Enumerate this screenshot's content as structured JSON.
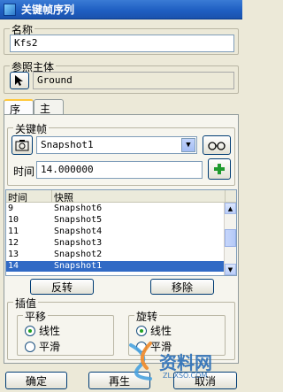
{
  "window": {
    "title": "关键帧序列"
  },
  "name_section": {
    "label": "名称",
    "value": "Kfs2"
  },
  "ref_section": {
    "label": "参照主体",
    "value": "Ground"
  },
  "tabs": [
    {
      "label": "序列",
      "active": true
    },
    {
      "label": "主体",
      "active": false
    }
  ],
  "keyframe": {
    "group_label": "关键帧",
    "selected": "Snapshot1",
    "time_label": "时间",
    "time_value": "14.000000"
  },
  "list": {
    "columns": [
      "时间",
      "快照"
    ],
    "rows": [
      {
        "time": "9",
        "snapshot": "Snapshot6"
      },
      {
        "time": "10",
        "snapshot": "Snapshot5"
      },
      {
        "time": "11",
        "snapshot": "Snapshot4"
      },
      {
        "time": "12",
        "snapshot": "Snapshot3"
      },
      {
        "time": "13",
        "snapshot": "Snapshot2"
      },
      {
        "time": "14",
        "snapshot": "Snapshot1",
        "selected": true
      }
    ]
  },
  "actions": {
    "reverse": "反转",
    "remove": "移除"
  },
  "interp": {
    "group_label": "插值",
    "translate": {
      "label": "平移",
      "options": [
        "线性",
        "平滑"
      ],
      "selected": 0
    },
    "rotate": {
      "label": "旋转",
      "options": [
        "线性",
        "平滑"
      ],
      "selected": 0
    }
  },
  "footer": {
    "ok": "确定",
    "regen": "再生",
    "cancel": "取消"
  },
  "watermark": {
    "text": "资料网",
    "sub": "ZL.XSO.COM"
  },
  "colors": {
    "title_bar": "#1f5fc2",
    "selection": "#316ac5",
    "dialog_bg": "#ece9d8"
  }
}
